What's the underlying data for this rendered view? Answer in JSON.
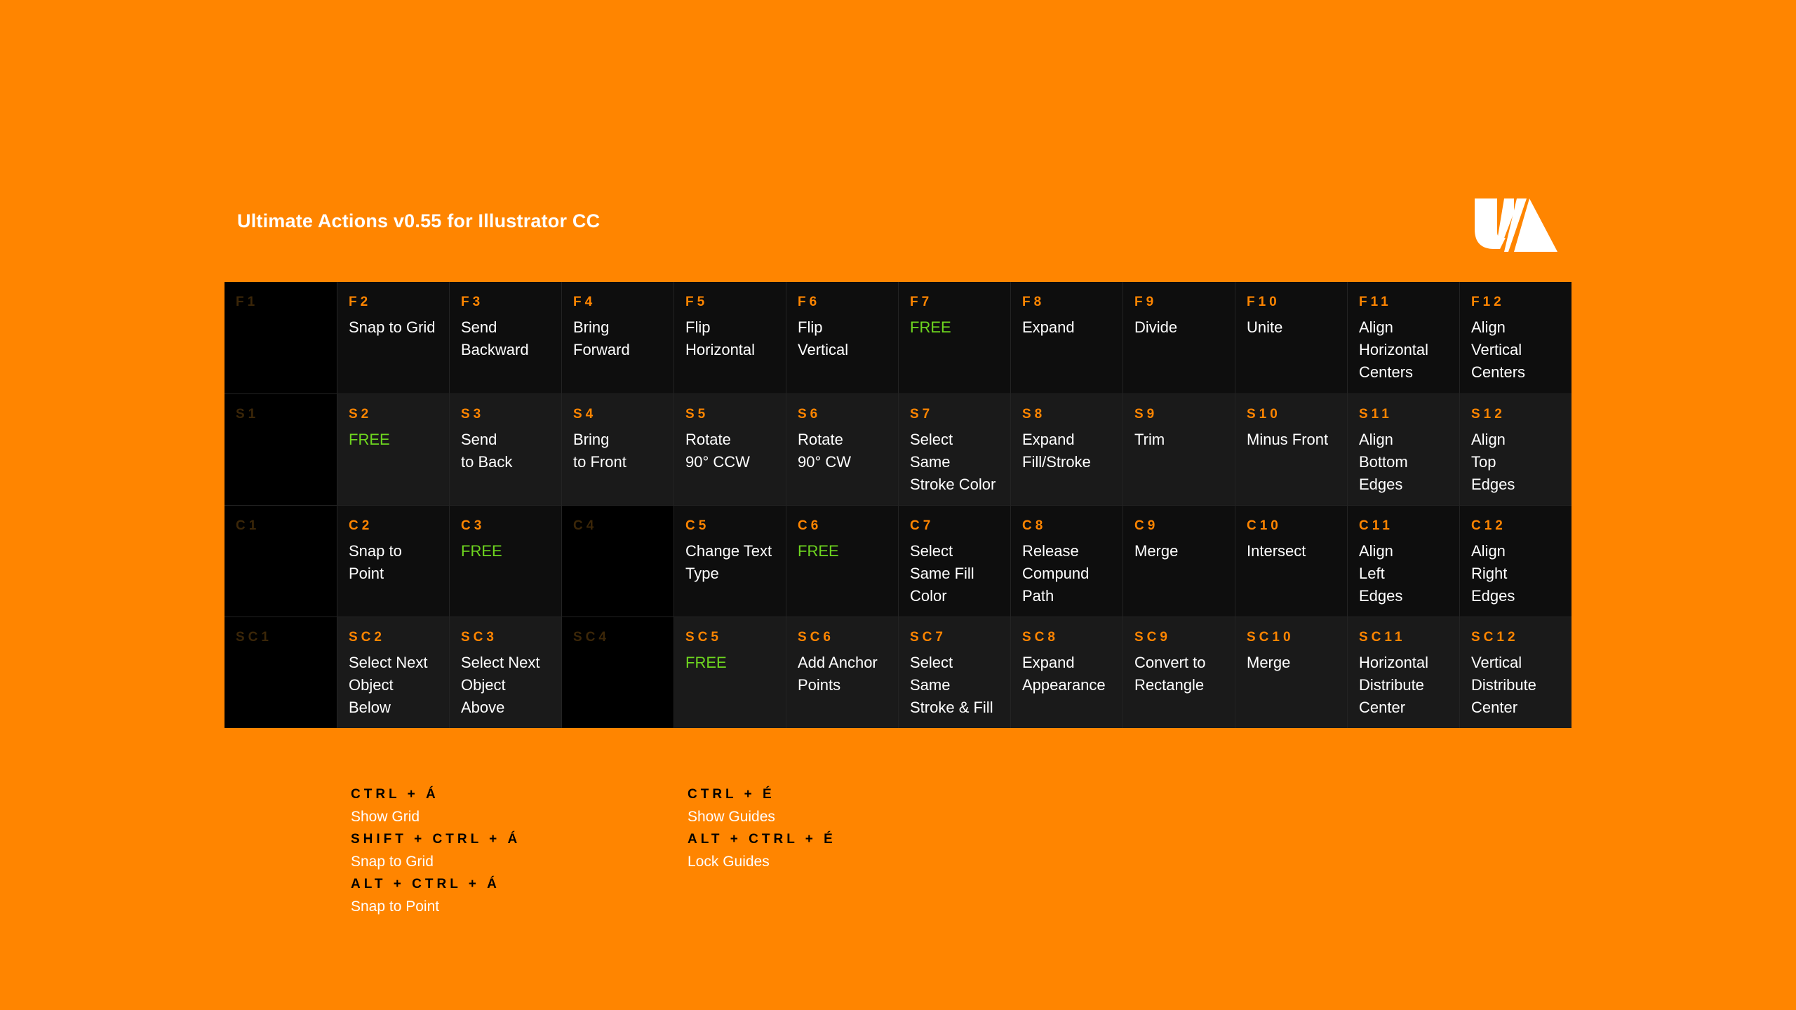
{
  "title": "Ultimate Actions v0.55 for Illustrator CC",
  "colors": {
    "background": "#FF8500",
    "accent": "#FF8500",
    "free": "#6ed61f",
    "text": "#ffffff"
  },
  "logo_icon": "ua-logo-icon",
  "rows": [
    {
      "cells": [
        {
          "key": "F1",
          "label": "",
          "dim": true
        },
        {
          "key": "F2",
          "label": "Snap to Grid"
        },
        {
          "key": "F3",
          "label": "Send\nBackward"
        },
        {
          "key": "F4",
          "label": "Bring\nForward"
        },
        {
          "key": "F5",
          "label": "Flip\nHorizontal"
        },
        {
          "key": "F6",
          "label": "Flip\nVertical"
        },
        {
          "key": "F7",
          "label": "FREE",
          "free": true
        },
        {
          "key": "F8",
          "label": "Expand"
        },
        {
          "key": "F9",
          "label": "Divide"
        },
        {
          "key": "F10",
          "label": "Unite"
        },
        {
          "key": "F11",
          "label": "Align\nHorizontal\nCenters"
        },
        {
          "key": "F12",
          "label": "Align\nVertical\nCenters"
        }
      ]
    },
    {
      "cells": [
        {
          "key": "S1",
          "label": "",
          "dim": true
        },
        {
          "key": "S2",
          "label": "FREE",
          "free": true
        },
        {
          "key": "S3",
          "label": "Send\nto Back"
        },
        {
          "key": "S4",
          "label": "Bring\nto Front"
        },
        {
          "key": "S5",
          "label": "Rotate\n90° CCW"
        },
        {
          "key": "S6",
          "label": "Rotate\n90° CW"
        },
        {
          "key": "S7",
          "label": "Select\nSame\nStroke Color"
        },
        {
          "key": "S8",
          "label": "Expand\nFill/Stroke"
        },
        {
          "key": "S9",
          "label": "Trim"
        },
        {
          "key": "S10",
          "label": "Minus Front"
        },
        {
          "key": "S11",
          "label": "Align\nBottom\nEdges"
        },
        {
          "key": "S12",
          "label": "Align\nTop\nEdges"
        }
      ]
    },
    {
      "cells": [
        {
          "key": "C1",
          "label": "",
          "dim": true
        },
        {
          "key": "C2",
          "label": "Snap to\nPoint"
        },
        {
          "key": "C3",
          "label": "FREE",
          "free": true
        },
        {
          "key": "C4",
          "label": "",
          "dim": true
        },
        {
          "key": "C5",
          "label": "Change Text\nType"
        },
        {
          "key": "C6",
          "label": "FREE",
          "free": true
        },
        {
          "key": "C7",
          "label": "Select\nSame Fill\nColor"
        },
        {
          "key": "C8",
          "label": "Release\nCompund\nPath"
        },
        {
          "key": "C9",
          "label": "Merge"
        },
        {
          "key": "C10",
          "label": "Intersect"
        },
        {
          "key": "C11",
          "label": "Align\nLeft\nEdges"
        },
        {
          "key": "C12",
          "label": "Align\nRight\nEdges"
        }
      ]
    },
    {
      "cells": [
        {
          "key": "SC1",
          "label": "",
          "dim": true
        },
        {
          "key": "SC2",
          "label": "Select Next\nObject\nBelow"
        },
        {
          "key": "SC3",
          "label": "Select Next\nObject\nAbove"
        },
        {
          "key": "SC4",
          "label": "",
          "dim": true
        },
        {
          "key": "SC5",
          "label": "FREE",
          "free": true
        },
        {
          "key": "SC6",
          "label": "Add Anchor\nPoints"
        },
        {
          "key": "SC7",
          "label": "Select\nSame\nStroke & Fill"
        },
        {
          "key": "SC8",
          "label": "Expand\nAppearance"
        },
        {
          "key": "SC9",
          "label": "Convert to\nRectangle"
        },
        {
          "key": "SC10",
          "label": "Merge"
        },
        {
          "key": "SC11",
          "label": "Horizontal\nDistribute\nCenter"
        },
        {
          "key": "SC12",
          "label": "Vertical\nDistribute\nCenter"
        }
      ]
    }
  ],
  "legend": [
    {
      "items": [
        {
          "keys": "CTRL + Á",
          "action": "Show Grid"
        },
        {
          "keys": "SHIFT + CTRL + Á",
          "action": "Snap to Grid"
        },
        {
          "keys": "ALT + CTRL + Á",
          "action": "Snap to Point"
        }
      ]
    },
    {
      "items": [
        {
          "keys": "CTRL + É",
          "action": "Show Guides"
        },
        {
          "keys": "ALT + CTRL + É",
          "action": "Lock Guides"
        }
      ]
    }
  ]
}
